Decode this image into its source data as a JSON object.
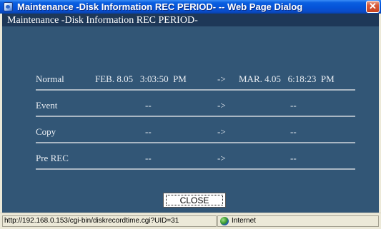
{
  "window": {
    "title": "Maintenance -Disk Information REC PERIOD- -- Web Page Dialog",
    "close_glyph": "✕"
  },
  "header": {
    "title": "Maintenance -Disk Information REC PERIOD-"
  },
  "rows": [
    {
      "label": "Normal",
      "start": "FEB. 8.05   3:03:50  PM",
      "arrow": "->",
      "end": "MAR. 4.05   6:18:23  PM"
    },
    {
      "label": "Event",
      "start": "--",
      "arrow": "->",
      "end": "--"
    },
    {
      "label": "Copy",
      "start": "--",
      "arrow": "->",
      "end": "--"
    },
    {
      "label": "Pre REC",
      "start": "--",
      "arrow": "->",
      "end": "--"
    }
  ],
  "buttons": {
    "close_label": "CLOSE"
  },
  "statusbar": {
    "url": "http://192.168.0.153/cgi-bin/diskrecordtime.cgi?UID=31",
    "zone": "Internet"
  },
  "colors": {
    "content_bg": "#325676",
    "header_bg": "#1e3858",
    "title_bar": "#0553d8"
  }
}
